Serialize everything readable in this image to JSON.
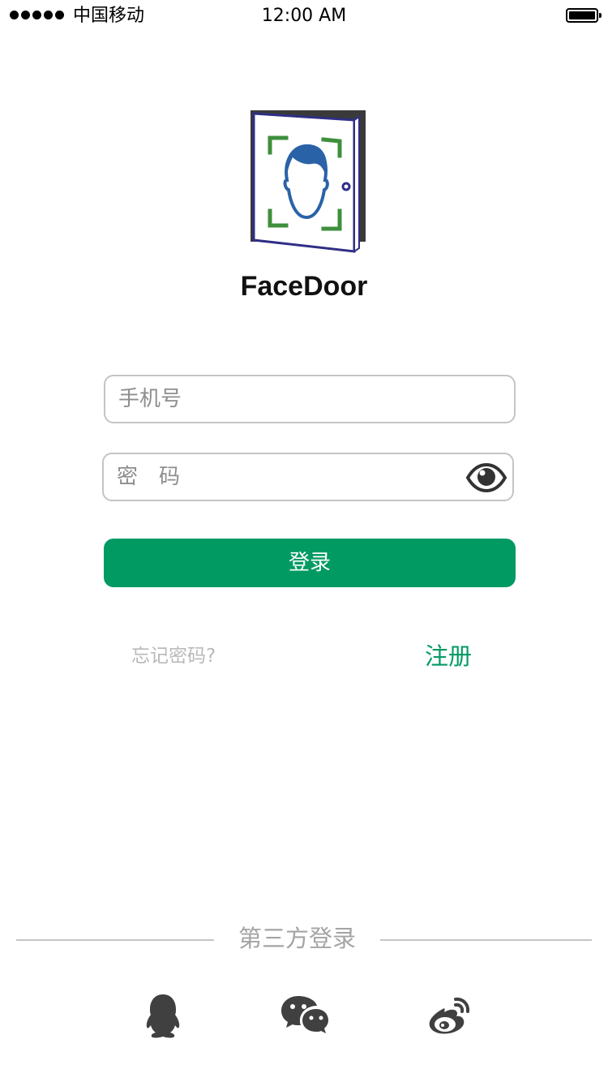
{
  "status_bar": {
    "carrier": "中国移动",
    "time": "12:00 AM",
    "signal_icon": "signal-dots-icon",
    "battery_icon": "battery-full-icon"
  },
  "app": {
    "name": "FaceDoor",
    "logo_icon": "face-door-logo-icon"
  },
  "login_form": {
    "phone_placeholder": "手机号",
    "password_placeholder": "密　码",
    "toggle_icon": "eye-icon",
    "submit_label": "登录",
    "forgot_label": "忘记密码?",
    "register_label": "注册"
  },
  "third_party": {
    "title": "第三方登录",
    "providers": [
      {
        "icon": "qq-icon"
      },
      {
        "icon": "wechat-icon"
      },
      {
        "icon": "weibo-icon"
      }
    ]
  },
  "colors": {
    "accent": "#029a63",
    "border": "#c4c4c4",
    "muted_text": "#b9b9b9",
    "icon_dark": "#404040"
  }
}
